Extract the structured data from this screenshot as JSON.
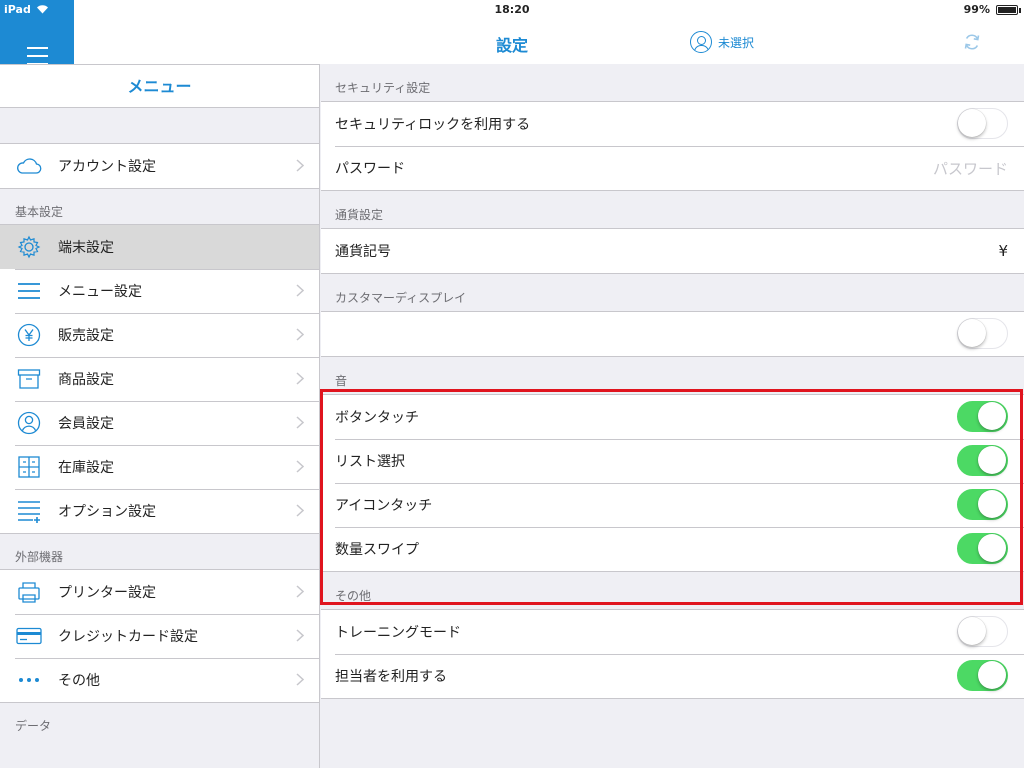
{
  "status_bar": {
    "carrier": "iPad",
    "time": "18:20",
    "battery": "99%",
    "battery_level": 0.99
  },
  "nav": {
    "title": "設定",
    "staff_label": "未選択",
    "menu_icon": "hamburger-icon",
    "sync_icon": "refresh-icon"
  },
  "sidebar": {
    "header": "メニュー",
    "account_group": [
      {
        "label": "アカウント設定",
        "icon": "cloud-icon"
      }
    ],
    "basic_title": "基本設定",
    "basic_items": [
      {
        "label": "端末設定",
        "icon": "gear-icon"
      },
      {
        "label": "メニュー設定",
        "icon": "list-icon"
      },
      {
        "label": "販売設定",
        "icon": "yen-icon"
      },
      {
        "label": "商品設定",
        "icon": "box-icon"
      },
      {
        "label": "会員設定",
        "icon": "person-icon"
      },
      {
        "label": "在庫設定",
        "icon": "grid-icon"
      },
      {
        "label": "オプション設定",
        "icon": "list-add-icon"
      }
    ],
    "external_title": "外部機器",
    "external_items": [
      {
        "label": "プリンター設定",
        "icon": "printer-icon"
      },
      {
        "label": "クレジットカード設定",
        "icon": "credit-card-icon"
      },
      {
        "label": "その他",
        "icon": "more-icon"
      }
    ],
    "data_title": "データ"
  },
  "main": {
    "security": {
      "title": "セキュリティ設定",
      "lock_label": "セキュリティロックを利用する",
      "lock_on": false,
      "password_label": "パスワード",
      "password_placeholder": "パスワード"
    },
    "currency": {
      "title": "通貨設定",
      "symbol_label": "通貨記号",
      "symbol_value": "¥"
    },
    "customer_display": {
      "title": "カスタマーディスプレイ",
      "enabled": false
    },
    "sound": {
      "title": "音",
      "button_touch": "ボタンタッチ",
      "list_select": "リスト選択",
      "icon_touch": "アイコンタッチ",
      "qty_swipe": "数量スワイプ"
    },
    "other": {
      "title": "その他",
      "training_label": "トレーニングモード",
      "training_on": false,
      "staff_label": "担当者を利用する",
      "staff_on": true
    }
  },
  "colors": {
    "accent": "#1d8ad3",
    "toggle_on": "#4cd964",
    "highlight": "#e0141e"
  }
}
